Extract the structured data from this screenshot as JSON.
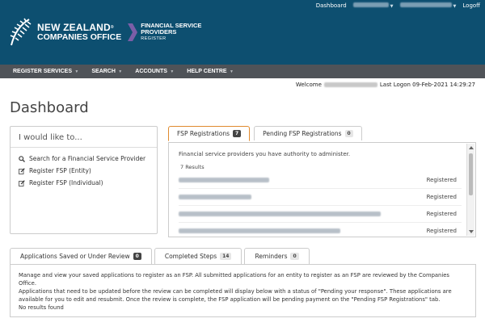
{
  "topbar": {
    "dashboard_label": "Dashboard",
    "logoff_label": "Logoff"
  },
  "logo": {
    "line1": "NEW ZEALAND",
    "line2": "COMPANIES OFFICE",
    "fsp_line1": "FINANCIAL SERVICE",
    "fsp_line2": "PROVIDERS",
    "fsp_line3": "REGISTER"
  },
  "nav": {
    "items": [
      {
        "label": "REGISTER SERVICES"
      },
      {
        "label": "SEARCH"
      },
      {
        "label": "ACCOUNTS"
      },
      {
        "label": "HELP CENTRE"
      }
    ]
  },
  "welcome": {
    "prefix": "Welcome",
    "last_logon": "Last Logon 09-Feb-2021 14:29:27"
  },
  "page_title": "Dashboard",
  "like_panel": {
    "title": "I would like to...",
    "items": [
      {
        "label": "Search for a Financial Service Provider",
        "icon": "search-icon"
      },
      {
        "label": "Register FSP (Entity)",
        "icon": "edit-icon"
      },
      {
        "label": "Register FSP (Individual)",
        "icon": "edit-icon"
      }
    ]
  },
  "fsp_tabs": [
    {
      "label": "FSP Registrations",
      "count": "7"
    },
    {
      "label": "Pending FSP Registrations",
      "count": "0"
    }
  ],
  "fsp_panel": {
    "description": "Financial service providers you have authority to administer.",
    "results": "7 Results",
    "rows": [
      {
        "status": "Registered"
      },
      {
        "status": "Registered"
      },
      {
        "status": "Registered"
      },
      {
        "status": "Registered"
      }
    ]
  },
  "app_tabs": [
    {
      "label": "Applications Saved or Under Review",
      "count": "0"
    },
    {
      "label": "Completed Steps",
      "count": "14"
    },
    {
      "label": "Reminders",
      "count": "0"
    }
  ],
  "apps_panel": {
    "line1": "Manage and view your saved applications to register as an FSP. All submitted applications for an entity to register as an FSP are reviewed by the Companies Office.",
    "line2": "Applications that need to be updated before the review can be completed will display below with a status of \"Pending your response\". These applications are",
    "line3": "available for you to edit and resubmit. Once the review is complete, the FSP application will be pending payment on the \"Pending FSP Registrations\" tab.",
    "no_results": "No results found"
  },
  "colors": {
    "header_bg": "#0d4f70",
    "nav_bg": "#4f5358",
    "accent_purple": "#7b5ea7",
    "active_tab_border": "#e08a2e"
  }
}
